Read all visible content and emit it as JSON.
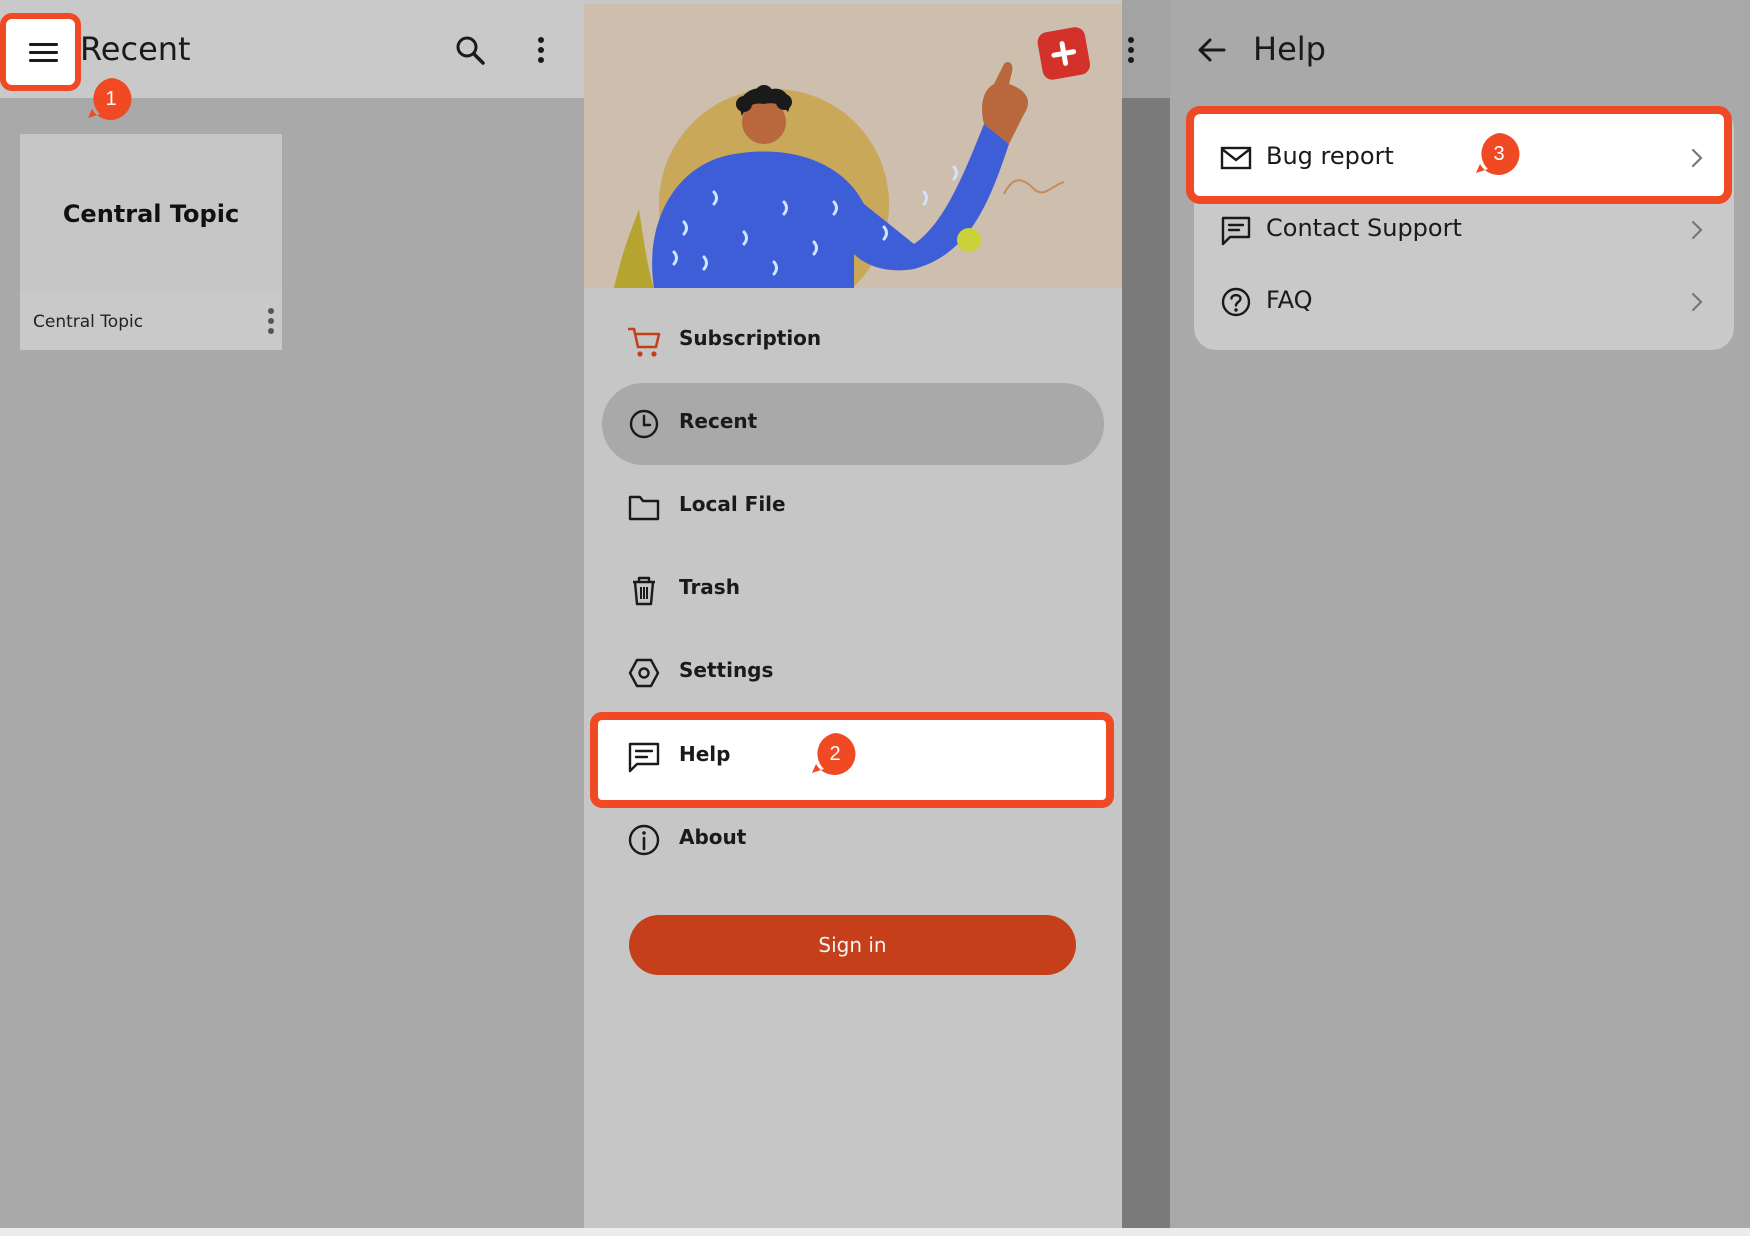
{
  "recent_screen": {
    "title": "Recent",
    "card": {
      "thumbnail_title": "Central Topic",
      "name": "Central Topic"
    }
  },
  "drawer": {
    "items": [
      {
        "label": "Subscription",
        "icon": "cart-icon"
      },
      {
        "label": "Recent",
        "icon": "clock-icon",
        "selected": true
      },
      {
        "label": "Local File",
        "icon": "folder-icon"
      },
      {
        "label": "Trash",
        "icon": "trash-icon"
      },
      {
        "label": "Settings",
        "icon": "settings-icon"
      },
      {
        "label": "Help",
        "icon": "chat-icon",
        "highlighted": true
      },
      {
        "label": "About",
        "icon": "info-icon"
      }
    ],
    "sign_in_label": "Sign in"
  },
  "help_screen": {
    "title": "Help",
    "items": [
      {
        "label": "Bug report",
        "icon": "mail-icon",
        "highlighted": true
      },
      {
        "label": "Contact Support",
        "icon": "chat-icon"
      },
      {
        "label": "FAQ",
        "icon": "question-icon"
      }
    ]
  },
  "steps": {
    "step1": "1",
    "step2": "2",
    "step3": "3"
  },
  "colors": {
    "highlight": "#f04a24",
    "accent": "#c53f1b",
    "panel_gray": "#a9a9a9",
    "drawer_gray": "#c6c6c6"
  }
}
